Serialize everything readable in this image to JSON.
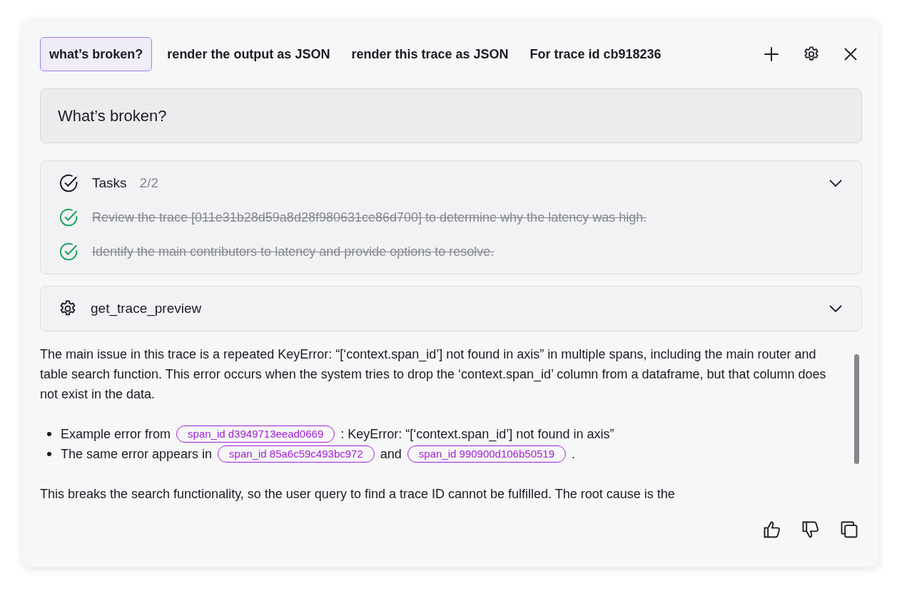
{
  "tabs": [
    {
      "label": "what’s broken?",
      "selected": true
    },
    {
      "label": "render the output as JSON",
      "selected": false
    },
    {
      "label": "render this trace as JSON",
      "selected": false
    },
    {
      "label": "For trace id cb918236",
      "selected": false
    }
  ],
  "prompt": "What’s broken?",
  "tasks": {
    "title": "Tasks",
    "count": "2/2",
    "expanded": false,
    "items": [
      {
        "text": "Review the trace [011e31b28d59a8d28f980631ce86d700] to determine why the latency was high.",
        "done": true
      },
      {
        "text": "Identify the main contributors to latency and provide options to resolve.",
        "done": true
      }
    ]
  },
  "tool_call": {
    "name": "get_trace_preview",
    "expanded": false
  },
  "answer": [
    {
      "kind": "paragraph",
      "parts": [
        {
          "kind": "text",
          "text": "The main issue in this trace is a repeated KeyError: “[‘context.span_id’] not found in axis” in multiple spans, including the main router and table search function. This error occurs when the system tries to drop the ‘context.span_id’ column from a dataframe, but that column does not exist in the data."
        }
      ]
    },
    {
      "kind": "list",
      "items": [
        {
          "parts": [
            {
              "kind": "text",
              "text": "Example error from"
            },
            {
              "kind": "span",
              "text": "span_id d3949713eead0669"
            },
            {
              "kind": "text",
              "text": ": KeyError: “[‘context.span_id’] not found in axis”"
            }
          ]
        },
        {
          "parts": [
            {
              "kind": "text",
              "text": "The same error appears in"
            },
            {
              "kind": "span",
              "text": "span_id 85a6c59c493bc972"
            },
            {
              "kind": "text",
              "text": "and"
            },
            {
              "kind": "span",
              "text": "span_id 990900d106b50519"
            },
            {
              "kind": "text",
              "text": "."
            }
          ]
        }
      ]
    },
    {
      "kind": "paragraph",
      "parts": [
        {
          "kind": "text",
          "text": "This breaks the search functionality, so the user query to find a trace ID cannot be fulfilled. The root cause is the"
        }
      ]
    }
  ]
}
